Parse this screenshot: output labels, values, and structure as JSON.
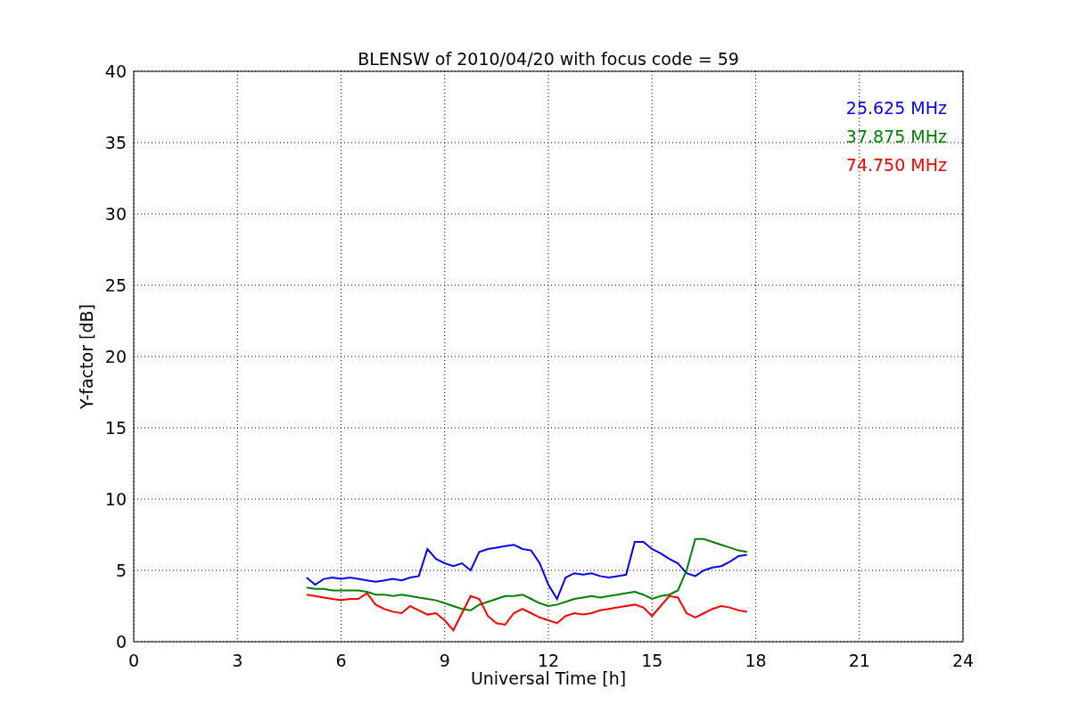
{
  "chart_data": {
    "type": "line",
    "title": "BLENSW of 2010/04/20 with focus code = 59",
    "xlabel": "Universal Time [h]",
    "ylabel": "Y-factor [dB]",
    "x": [
      5.0,
      5.25,
      5.5,
      5.75,
      6.0,
      6.25,
      6.5,
      6.75,
      7.0,
      7.25,
      7.5,
      7.75,
      8.0,
      8.25,
      8.5,
      8.75,
      9.0,
      9.25,
      9.5,
      9.75,
      10.0,
      10.25,
      10.5,
      10.75,
      11.0,
      11.25,
      11.5,
      11.75,
      12.0,
      12.25,
      12.5,
      12.75,
      13.0,
      13.25,
      13.5,
      13.75,
      14.0,
      14.25,
      14.5,
      14.75,
      15.0,
      15.25,
      15.5,
      15.75,
      16.0,
      16.25,
      16.5,
      16.75,
      17.0,
      17.25,
      17.5,
      17.75
    ],
    "series": [
      {
        "name": "25.625 MHz",
        "color": "#0000ff",
        "values": [
          4.5,
          4.0,
          4.4,
          4.5,
          4.4,
          4.5,
          4.4,
          4.3,
          4.2,
          4.3,
          4.4,
          4.3,
          4.5,
          4.6,
          6.5,
          5.8,
          5.5,
          5.3,
          5.5,
          5.0,
          6.3,
          6.5,
          6.6,
          6.7,
          6.8,
          6.5,
          6.4,
          5.5,
          4.0,
          3.0,
          4.5,
          4.8,
          4.7,
          4.8,
          4.6,
          4.5,
          4.6,
          4.7,
          7.0,
          7.0,
          6.5,
          6.2,
          5.8,
          5.5,
          4.8,
          4.6,
          5.0,
          5.2,
          5.3,
          5.6,
          6.0,
          6.1
        ]
      },
      {
        "name": "37.875 MHz",
        "color": "#008000",
        "values": [
          3.8,
          3.7,
          3.7,
          3.6,
          3.6,
          3.6,
          3.6,
          3.5,
          3.3,
          3.3,
          3.2,
          3.3,
          3.2,
          3.1,
          3.0,
          2.9,
          2.7,
          2.5,
          2.3,
          2.2,
          2.6,
          2.8,
          3.0,
          3.2,
          3.2,
          3.3,
          3.0,
          2.7,
          2.5,
          2.6,
          2.8,
          3.0,
          3.1,
          3.2,
          3.1,
          3.2,
          3.3,
          3.4,
          3.5,
          3.3,
          3.0,
          3.2,
          3.3,
          3.6,
          5.0,
          7.2,
          7.2,
          7.0,
          6.8,
          6.6,
          6.4,
          6.3
        ]
      },
      {
        "name": "74.750 MHz",
        "color": "#ff0000",
        "values": [
          3.3,
          3.2,
          3.1,
          3.0,
          2.9,
          3.0,
          3.0,
          3.4,
          2.6,
          2.3,
          2.1,
          2.0,
          2.5,
          2.2,
          1.9,
          2.0,
          1.5,
          0.8,
          2.0,
          3.2,
          3.0,
          1.8,
          1.3,
          1.2,
          2.0,
          2.3,
          2.0,
          1.7,
          1.5,
          1.3,
          1.8,
          2.0,
          1.9,
          2.0,
          2.2,
          2.3,
          2.4,
          2.5,
          2.6,
          2.4,
          1.8,
          2.5,
          3.2,
          3.1,
          2.0,
          1.7,
          2.0,
          2.3,
          2.5,
          2.4,
          2.2,
          2.1
        ]
      }
    ],
    "grid": true,
    "xlim": [
      0,
      24
    ],
    "ylim": [
      0,
      40
    ],
    "xticks": [
      0,
      3,
      6,
      9,
      12,
      15,
      18,
      21,
      24
    ],
    "yticks": [
      0,
      5,
      10,
      15,
      20,
      25,
      30,
      35,
      40
    ]
  }
}
